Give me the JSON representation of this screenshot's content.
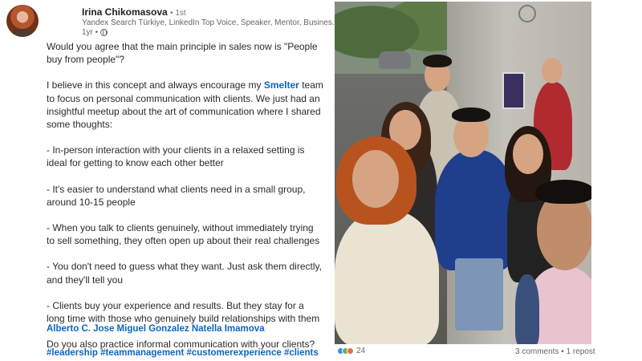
{
  "author": {
    "name": "Irina Chikomasova",
    "degree": "• 1st",
    "headline": "Yandex Search Türkiye, LinkedIn Top Voice, Speaker, Mentor, Busines...",
    "time": "1yr •"
  },
  "menu": {
    "more": "•••"
  },
  "post": {
    "p1": "Would you agree that the main principle in sales now is \"People buy from people\"?",
    "p2_pre": "I believe in this concept and always encourage my ",
    "p2_brand": "Smelter",
    "p2_post": " team to focus on personal communication with clients. We just had an insightful meetup about the art of communication where I shared some thoughts:",
    "b1": "- In-person interaction with your clients in a relaxed setting is ideal for getting to know each other better",
    "b2": "- It's easier to understand what clients need in a small group, around 10-15 people",
    "b3": "- When you talk to clients genuinely, without immediately trying to sell something, they often open up about their real challenges",
    "b4": "- You don't need to guess what they want. Just ask them directly, and they'll tell you",
    "b5": "- Clients buy your experience and results. But they stay for a long time with those who genuinely build relationships with them",
    "question": "Do you also practice informal communication with your clients?",
    "mentions": "Alberto C. Jose Miguel Gonzalez Natella Imamova",
    "hashtags": "#leadership #teammanagement #customerexperience #clients"
  },
  "footer": {
    "reaction_count": "24",
    "stats": "3 comments • 1 repost"
  },
  "icons": {
    "globe": "globe-icon",
    "more": "more-icon",
    "like": "like-reaction-icon",
    "celebrate": "celebrate-reaction-icon",
    "support": "support-reaction-icon"
  },
  "colors": {
    "link": "#0a66c2",
    "text": "#2a2a2a",
    "meta": "#666666"
  }
}
